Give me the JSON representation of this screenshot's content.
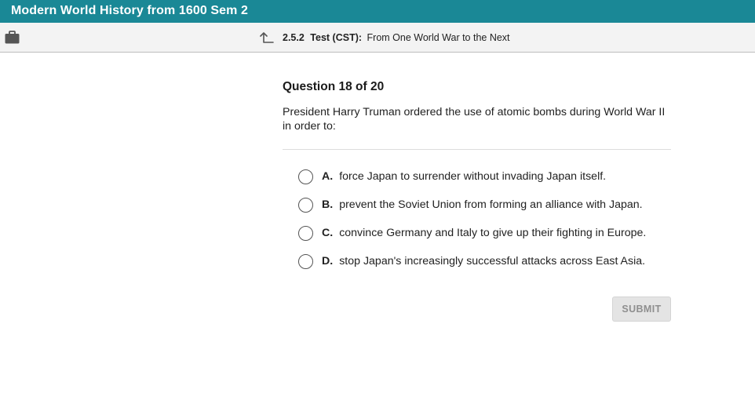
{
  "header": {
    "course_title": "Modern World History from 1600 Sem 2"
  },
  "breadcrumb": {
    "number": "2.5.2",
    "type": "Test (CST):",
    "name": "From One World War to the Next"
  },
  "icons": {
    "briefcase": "briefcase-icon",
    "up": "up-arrow-icon"
  },
  "question": {
    "heading": "Question 18 of 20",
    "prompt": "President Harry Truman ordered the use of atomic bombs during World War II in order to:",
    "options": [
      {
        "letter": "A.",
        "text": "force Japan to surrender without invading Japan itself."
      },
      {
        "letter": "B.",
        "text": "prevent the Soviet Union from forming an alliance with Japan."
      },
      {
        "letter": "C.",
        "text": "convince Germany and Italy to give up their fighting in Europe."
      },
      {
        "letter": "D.",
        "text": "stop Japan's increasingly successful attacks across East Asia."
      }
    ]
  },
  "actions": {
    "submit_label": "SUBMIT"
  },
  "colors": {
    "header_bg": "#1a8896",
    "subbar_bg": "#f3f3f3",
    "submit_disabled_bg": "#e4e4e4"
  }
}
